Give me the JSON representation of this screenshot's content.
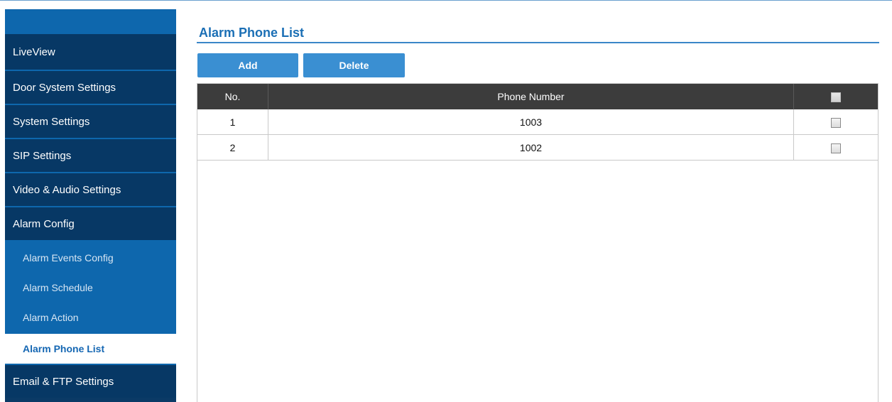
{
  "sidebar": {
    "items": [
      {
        "label": "LiveView"
      },
      {
        "label": "Door System Settings"
      },
      {
        "label": "System Settings"
      },
      {
        "label": "SIP Settings"
      },
      {
        "label": "Video & Audio Settings"
      },
      {
        "label": "Alarm Config"
      }
    ],
    "sub_items": [
      {
        "label": "Alarm Events Config"
      },
      {
        "label": "Alarm Schedule"
      },
      {
        "label": "Alarm Action"
      },
      {
        "label": "Alarm Phone List",
        "active": true
      }
    ],
    "after_items": [
      {
        "label": "Email & FTP Settings"
      }
    ]
  },
  "main": {
    "title": "Alarm Phone List",
    "buttons": {
      "add": "Add",
      "delete": "Delete"
    },
    "table": {
      "headers": {
        "no": "No.",
        "phone": "Phone Number"
      },
      "rows": [
        {
          "no": "1",
          "phone": "1003",
          "checked": false
        },
        {
          "no": "2",
          "phone": "1002",
          "checked": false
        }
      ]
    }
  },
  "colors": {
    "nav_dark": "#073865",
    "nav_blue": "#0e67ad",
    "accent": "#1b6fb5",
    "button": "#3a8fd2",
    "table_header": "#3c3c3c"
  }
}
